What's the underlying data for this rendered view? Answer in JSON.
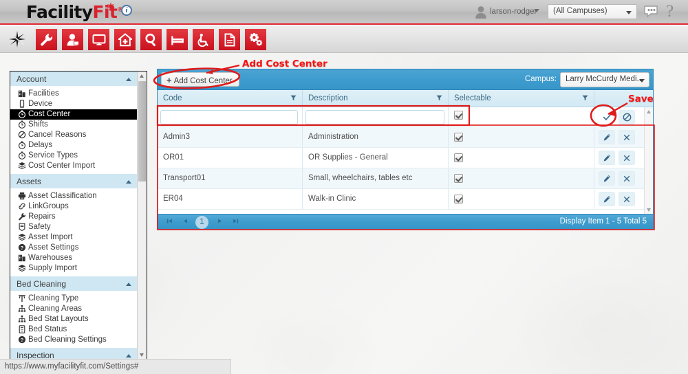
{
  "brand": {
    "name_part1": "Facility",
    "name_part2": "Fit",
    "registered": "®",
    "info_icon": "i"
  },
  "header": {
    "user_icon": "user-icon",
    "user_name": "larson-rodger",
    "campus_value": "(All Campuses)",
    "chat_icon": "chat-bubble-icon",
    "help_icon": "?"
  },
  "toolbar": {
    "sparkle_icon": "sparkle-icon",
    "buttons": [
      {
        "name": "wrench-icon",
        "label": "Maintenance"
      },
      {
        "name": "user-profile-icon",
        "label": "Staff"
      },
      {
        "name": "monitor-icon",
        "label": "Dashboard"
      },
      {
        "name": "home-plus-icon",
        "label": "Facility"
      },
      {
        "name": "magnifier-icon",
        "label": "Search"
      },
      {
        "name": "bed-icon",
        "label": "Bed Cleaning"
      },
      {
        "name": "wheelchair-icon",
        "label": "Transport"
      },
      {
        "name": "document-icon",
        "label": "Reports"
      },
      {
        "name": "gears-icon",
        "label": "Settings"
      }
    ]
  },
  "sidebar": {
    "sections": [
      {
        "title": "Account",
        "collapse_icon": "caret-up-icon",
        "items": [
          {
            "label": "Facilities",
            "icon": "building-icon",
            "selected": false
          },
          {
            "label": "Device",
            "icon": "device-icon",
            "selected": false
          },
          {
            "label": "Cost Center",
            "icon": "clock-icon",
            "selected": true
          },
          {
            "label": "Shifts",
            "icon": "clock-icon",
            "selected": false
          },
          {
            "label": "Cancel Reasons",
            "icon": "no-entry-icon",
            "selected": false
          },
          {
            "label": "Delays",
            "icon": "clock-icon",
            "selected": false
          },
          {
            "label": "Service Types",
            "icon": "clock-icon",
            "selected": false
          },
          {
            "label": "Cost Center Import",
            "icon": "stack-icon",
            "selected": false
          }
        ]
      },
      {
        "title": "Assets",
        "collapse_icon": "caret-up-icon",
        "items": [
          {
            "label": "Asset Classification",
            "icon": "printer-icon",
            "selected": false
          },
          {
            "label": "LinkGroups",
            "icon": "link-icon",
            "selected": false
          },
          {
            "label": "Repairs",
            "icon": "wrench-icon",
            "selected": false
          },
          {
            "label": "Safety",
            "icon": "shield-icon",
            "selected": false
          },
          {
            "label": "Asset Import",
            "icon": "stack-icon",
            "selected": false
          },
          {
            "label": "Asset Settings",
            "icon": "question-icon",
            "selected": false
          },
          {
            "label": "Warehouses",
            "icon": "building-icon",
            "selected": false
          },
          {
            "label": "Supply Import",
            "icon": "stack-icon",
            "selected": false
          }
        ]
      },
      {
        "title": "Bed Cleaning",
        "collapse_icon": "caret-up-icon",
        "items": [
          {
            "label": "Cleaning Type",
            "icon": "mop-icon",
            "selected": false
          },
          {
            "label": "Cleaning Areas",
            "icon": "hierarchy-icon",
            "selected": false
          },
          {
            "label": "Bed Stat Layouts",
            "icon": "hierarchy-icon",
            "selected": false
          },
          {
            "label": "Bed Status",
            "icon": "list-icon",
            "selected": false
          },
          {
            "label": "Bed Cleaning Settings",
            "icon": "question-icon",
            "selected": false
          }
        ]
      },
      {
        "title": "Inspection",
        "collapse_icon": "caret-up-icon",
        "items": []
      }
    ]
  },
  "grid": {
    "add_button_label": "Add Cost Center",
    "add_button_plus": "+",
    "campus_label": "Campus:",
    "campus_value": "Larry McCurdy Medi...",
    "columns": [
      {
        "label": "Code",
        "filter_icon": "funnel-icon"
      },
      {
        "label": "Description",
        "filter_icon": "funnel-icon"
      },
      {
        "label": "Selectable",
        "filter_icon": "funnel-icon"
      },
      {
        "label": "",
        "filter_icon": ""
      }
    ],
    "edit_row": {
      "code_value": "",
      "code_placeholder": "",
      "description_value": "",
      "description_placeholder": "",
      "selectable": true,
      "save_icon": "check-icon",
      "cancel_icon": "no-entry-icon"
    },
    "rows": [
      {
        "code": "Admin3",
        "description": "Administration",
        "selectable": true,
        "edit_icon": "pencil-icon",
        "delete_icon": "close-icon"
      },
      {
        "code": "OR01",
        "description": "OR Supplies - General",
        "selectable": true,
        "edit_icon": "pencil-icon",
        "delete_icon": "close-icon"
      },
      {
        "code": "Transport01",
        "description": "Small, wheelchairs, tables etc",
        "selectable": true,
        "edit_icon": "pencil-icon",
        "delete_icon": "close-icon"
      },
      {
        "code": "ER04",
        "description": "Walk-in Clinic",
        "selectable": true,
        "edit_icon": "pencil-icon",
        "delete_icon": "close-icon"
      }
    ],
    "pager": {
      "first_icon": "first-page-icon",
      "prev_icon": "prev-page-icon",
      "current_page": "1",
      "next_icon": "next-page-icon",
      "last_icon": "last-page-icon",
      "info": "Display Item 1 - 5 Total 5"
    }
  },
  "annotations": [
    {
      "text": "Add Cost Center",
      "color": "#fb1111"
    },
    {
      "text": "Save",
      "color": "#fb1111"
    }
  ],
  "status_bar": {
    "url": "https://www.myfacilityfit.com/Settings#"
  }
}
